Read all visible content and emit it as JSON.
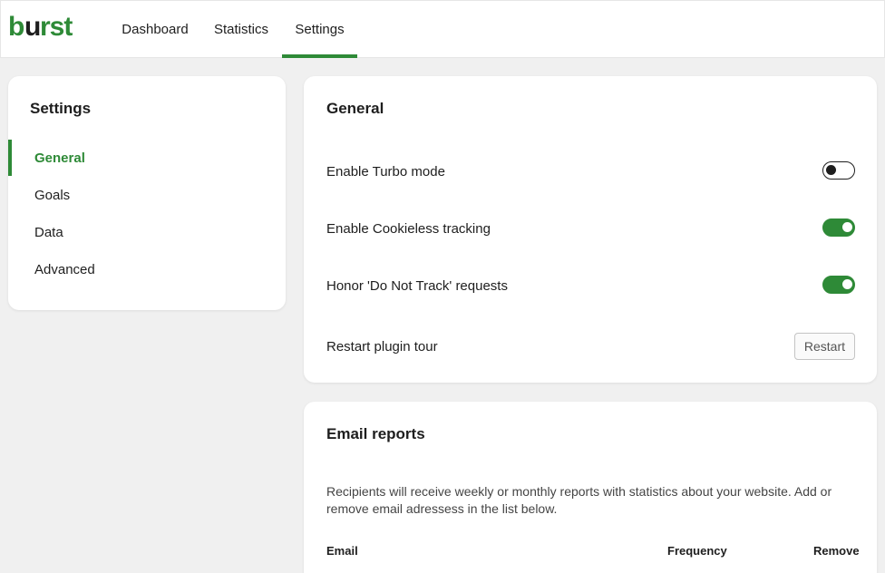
{
  "header": {
    "logo_text": "burst",
    "tabs": [
      {
        "label": "Dashboard"
      },
      {
        "label": "Statistics"
      },
      {
        "label": "Settings"
      }
    ]
  },
  "sidebar": {
    "title": "Settings",
    "items": [
      {
        "label": "General"
      },
      {
        "label": "Goals"
      },
      {
        "label": "Data"
      },
      {
        "label": "Advanced"
      }
    ]
  },
  "general": {
    "title": "General",
    "turbo_label": "Enable Turbo mode",
    "turbo_on": false,
    "cookieless_label": "Enable Cookieless tracking",
    "cookieless_on": true,
    "dnt_label": "Honor 'Do Not Track' requests",
    "dnt_on": true,
    "restart_label": "Restart plugin tour",
    "restart_button": "Restart"
  },
  "email_reports": {
    "title": "Email reports",
    "description": "Recipients will receive weekly or monthly reports with statistics about your website. Add or remove email adressess in the list below.",
    "columns": [
      "Email",
      "Frequency",
      "Remove"
    ]
  },
  "colors": {
    "accent": "#2e8a37",
    "background": "#f0f0f0",
    "card": "#ffffff"
  }
}
